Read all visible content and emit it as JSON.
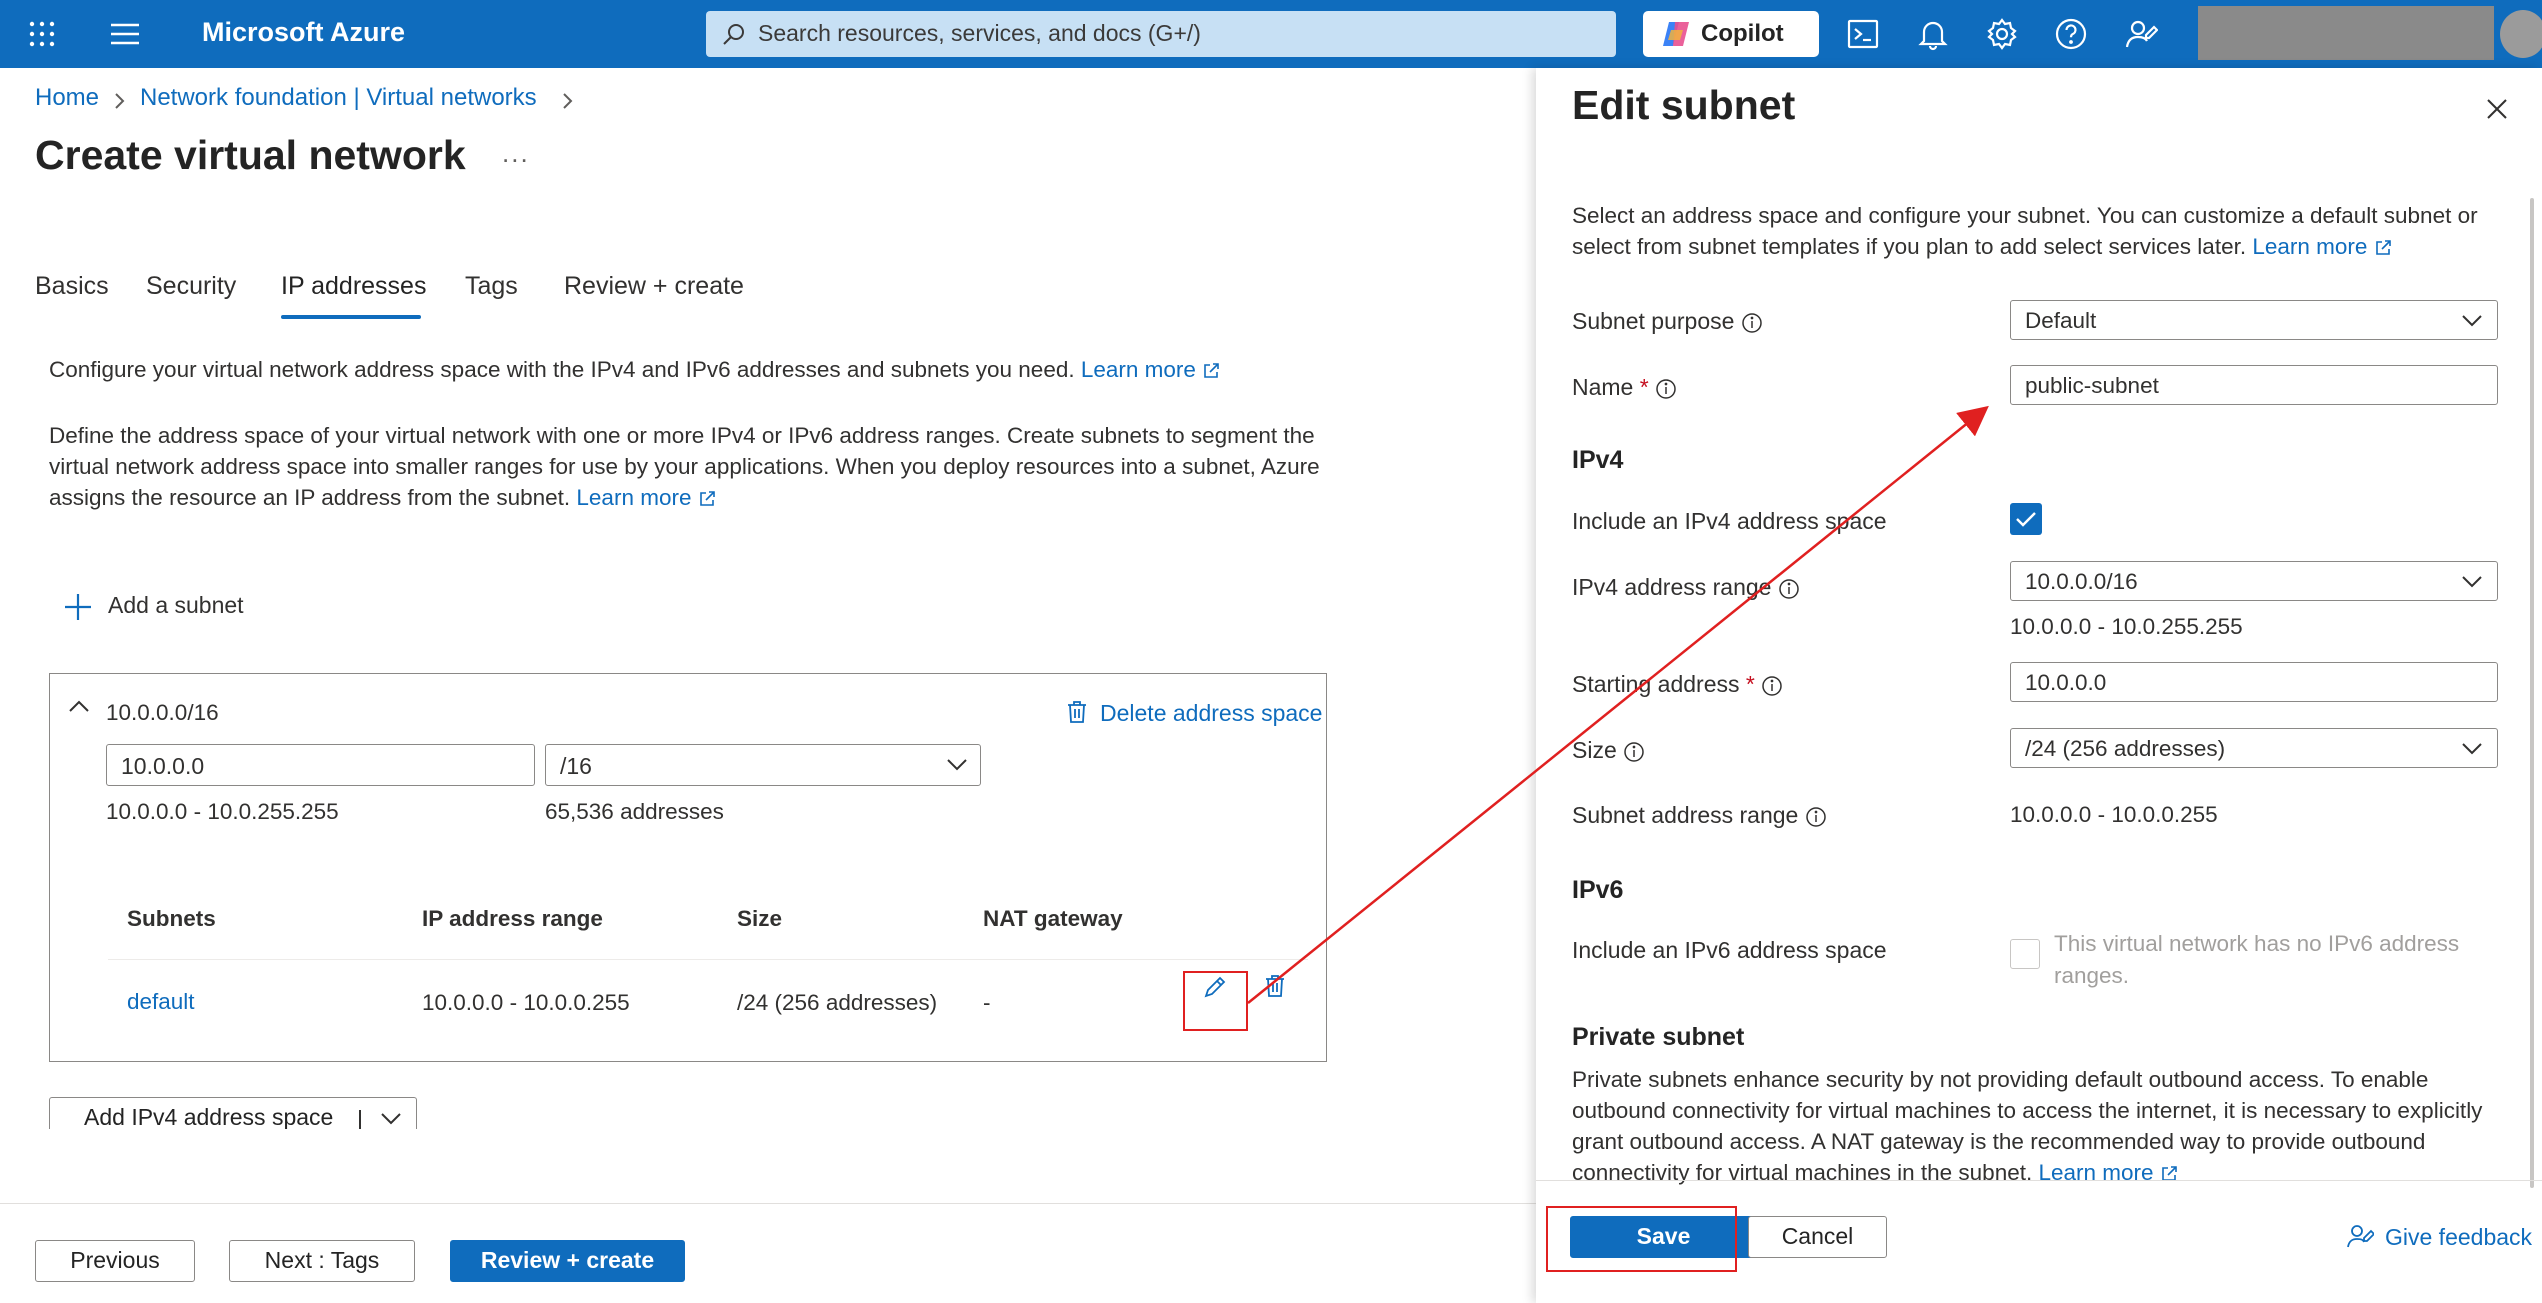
{
  "topbar": {
    "brand": "Microsoft Azure",
    "search_placeholder": "Search resources, services, and docs (G+/)",
    "copilot_label": "Copilot"
  },
  "breadcrumb": {
    "home": "Home",
    "parent": "Network foundation | Virtual networks"
  },
  "page": {
    "title": "Create virtual network",
    "more": "..."
  },
  "tabs": [
    {
      "label": "Basics"
    },
    {
      "label": "Security"
    },
    {
      "label": "IP addresses"
    },
    {
      "label": "Tags"
    },
    {
      "label": "Review + create"
    }
  ],
  "intro": {
    "line1": "Configure your virtual network address space with the IPv4 and IPv6 addresses and subnets you need.",
    "learn_more": "Learn more",
    "p2_line1": "Define the address space of your virtual network with one or more IPv4 or IPv6 address ranges. Create subnets to segment the",
    "p2_line2": "virtual network address space into smaller ranges for use by your applications. When you deploy resources into a subnet, Azure",
    "p2_line3": "assigns the resource an IP address from the subnet."
  },
  "add_subnet": "Add a subnet",
  "address_space": {
    "title": "10.0.0.0/16",
    "delete_label": "Delete address space",
    "start_value": "10.0.0.0",
    "prefix_value": "/16",
    "range_text": "10.0.0.0 - 10.0.255.255",
    "count_text": "65,536 addresses",
    "headers": [
      "Subnets",
      "IP address range",
      "Size",
      "NAT gateway"
    ],
    "rows": [
      {
        "name": "default",
        "range": "10.0.0.0 - 10.0.0.255",
        "size": "/24 (256 addresses)",
        "nat": "-"
      }
    ]
  },
  "add_ipv4_label": "Add IPv4 address space",
  "footer": {
    "previous": "Previous",
    "next": "Next : Tags",
    "review": "Review + create"
  },
  "panel": {
    "title": "Edit subnet",
    "desc_line1": "Select an address space and configure your subnet. You can customize a default subnet or",
    "desc_line2": "select from subnet templates if you plan to add select services later.",
    "learn_more": "Learn more",
    "subnet_purpose_label": "Subnet purpose",
    "subnet_purpose_value": "Default",
    "name_label": "Name",
    "name_value": "public-subnet",
    "ipv4_heading": "IPv4",
    "include_ipv4_label": "Include an IPv4 address space",
    "ipv4_range_label": "IPv4 address range",
    "ipv4_range_value": "10.0.0.0/16",
    "ipv4_range_text": "10.0.0.0 - 10.0.255.255",
    "starting_address_label": "Starting address",
    "starting_address_value": "10.0.0.0",
    "size_label": "Size",
    "size_value": "/24 (256 addresses)",
    "subnet_range_label": "Subnet address range",
    "subnet_range_value": "10.0.0.0 - 10.0.0.255",
    "ipv6_heading": "IPv6",
    "include_ipv6_label": "Include an IPv6 address space",
    "ipv6_note_line1": "This virtual network has no IPv6 address",
    "ipv6_note_line2": "ranges.",
    "private_heading": "Private subnet",
    "private_line1": "Private subnets enhance security by not providing default outbound access. To enable",
    "private_line2": "outbound connectivity for virtual machines to access the internet, it is necessary to explicitly",
    "private_line3": "grant outbound access. A NAT gateway is the recommended way to provide outbound",
    "private_line4": "connectivity for virtual machines in the subnet.",
    "save": "Save",
    "cancel": "Cancel",
    "feedback": "Give feedback"
  },
  "colors": {
    "azure_blue": "#0f6cbd",
    "annotation_red": "#e02020"
  }
}
